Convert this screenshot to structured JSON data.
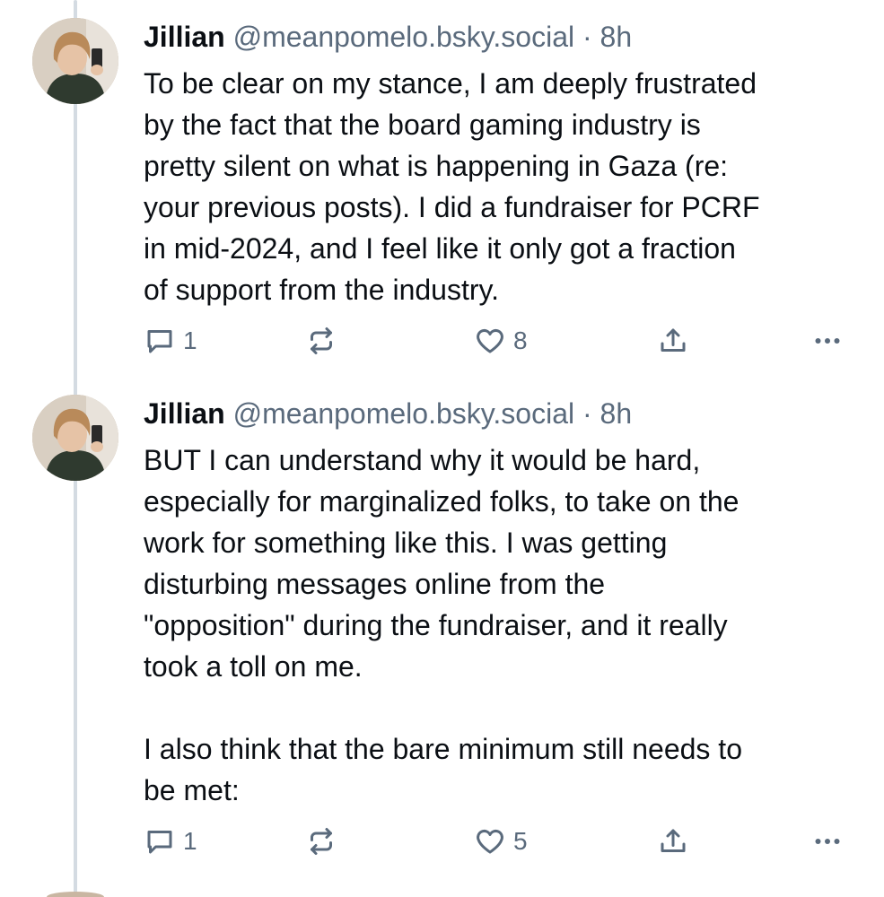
{
  "posts": [
    {
      "author": "Jillian",
      "handle": "@meanpomelo.bsky.social",
      "separator": "·",
      "time": "8h",
      "text": "To be clear on my stance, I am deeply frustrated\nby the fact that the board gaming industry is\npretty silent on what is happening in Gaza (re:\nyour previous posts). I did a fundraiser for PCRF\nin mid-2024, and I feel like it only got a fraction\nof support from the industry.",
      "replies": "1",
      "likes": "8",
      "icons": [
        "reply-icon",
        "repost-icon",
        "like-icon",
        "share-icon",
        "more-icon"
      ]
    },
    {
      "author": "Jillian",
      "handle": "@meanpomelo.bsky.social",
      "separator": "·",
      "time": "8h",
      "text": "BUT I can understand why it would be hard,\nespecially for marginalized folks, to take on the\nwork for something like this. I was getting\ndisturbing messages online from the\n\"opposition\" during the fundraiser, and it really\ntook a toll on me.\n\nI also think that the bare minimum still needs to\nbe met:",
      "replies": "1",
      "likes": "5",
      "icons": [
        "reply-icon",
        "repost-icon",
        "like-icon",
        "share-icon",
        "more-icon"
      ]
    }
  ],
  "colors": {
    "text": "#0b0f14",
    "muted": "#5a6a7c",
    "thread_line": "#d4dbe2",
    "background": "#ffffff"
  }
}
